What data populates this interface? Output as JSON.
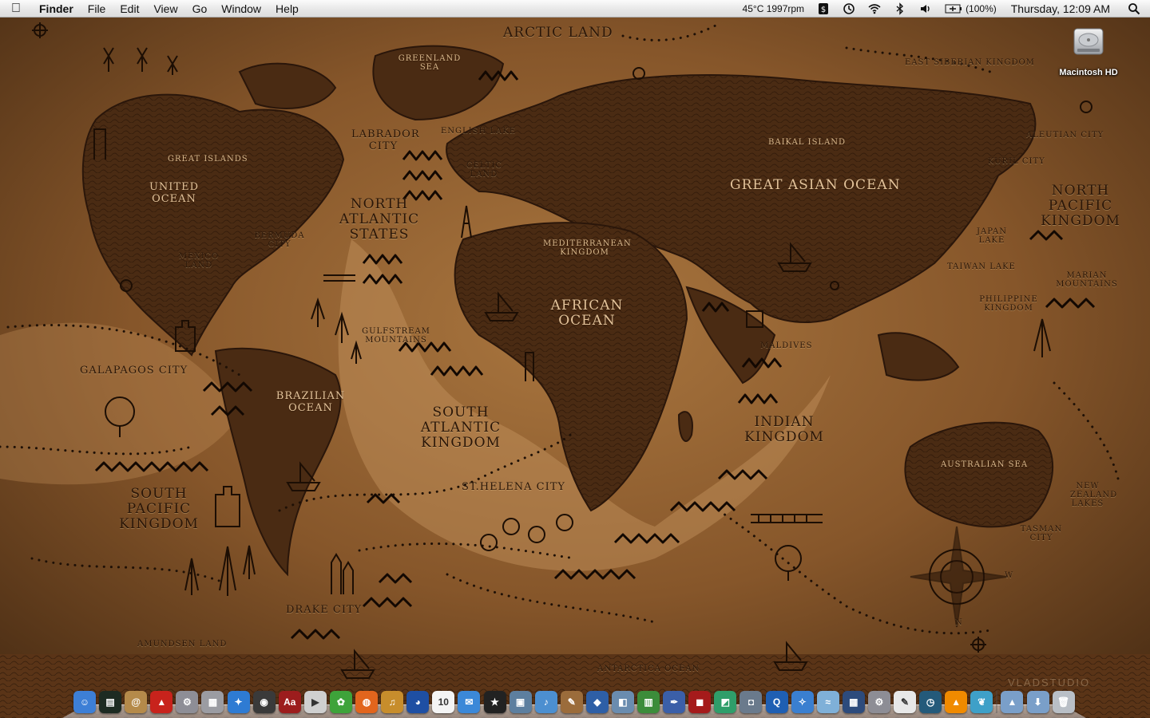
{
  "menubar": {
    "app_name": "Finder",
    "menus": [
      "File",
      "Edit",
      "View",
      "Go",
      "Window",
      "Help"
    ],
    "sensors": "45°C 1997rpm",
    "battery": "(100%)",
    "clock": "Thursday, 12:09 AM"
  },
  "desktop": {
    "hd_label": "Macintosh HD"
  },
  "map": {
    "labels": {
      "arctic_land": "ARCTIC LAND",
      "greenland_sea": "GREENLAND SEA",
      "east_siberian": "EAST SIBERIAN KINGDOM",
      "labrador": "LABRADOR CITY",
      "english_lake": "ENGLISH LAKE",
      "celtic_land": "CELTIC LAND",
      "great_islands": "GREAT ISLANDS",
      "united_ocean": "UNITED OCEAN",
      "baikal": "BAIKAL ISLAND",
      "aleutian": "ALEUTIAN CITY",
      "kuril": "KURIL CITY",
      "great_asian": "GREAT ASIAN OCEAN",
      "north_pacific": "NORTH PACIFIC KINGDOM",
      "north_atlantic": "NORTH ATLANTIC STATES",
      "bermuda": "BERMUDA CITY",
      "mexico": "MEXICO LAND",
      "mediterranean": "MEDITERRANEAN KINGDOM",
      "japan_lake": "JAPAN LAKE",
      "taiwan_lake": "TAIWAN LAKE",
      "marian": "MARIAN MOUNTAINS",
      "philippine": "PHILIPPINE KINGDOM",
      "african_ocean": "AFRICAN OCEAN",
      "gulfstream": "GULFSTREAM MOUNTAINS",
      "maldives": "MALDIVES",
      "galapagos": "GALAPAGOS CITY",
      "brazilian": "BRAZILIAN OCEAN",
      "south_atlantic": "SOUTH ATLANTIC KINGDOM",
      "indian_kingdom": "INDIAN KINGDOM",
      "australian_sea": "AUSTRALIAN SEA",
      "st_helena": "ST.HELENA CITY",
      "new_zealand": "NEW ZEALAND LAKES",
      "south_pacific": "SOUTH PACIFIC KINGDOM",
      "tasman": "TASMAN CITY",
      "drake": "DRAKE CITY",
      "amundsen": "AMUNDSEN LAND",
      "antarctica": "ANTARCTICA OCEAN",
      "compass_w": "W",
      "compass_n": "N"
    },
    "watermark": "VLADSTUDIO"
  },
  "dock": {
    "items": [
      {
        "name": "finder",
        "color": "#3d7fd6",
        "glyph": "☺"
      },
      {
        "name": "activity-monitor",
        "color": "#1d2b22",
        "glyph": "▤"
      },
      {
        "name": "address-book",
        "color": "#b58a4a",
        "glyph": "@"
      },
      {
        "name": "fire-hydrant",
        "color": "#c8231c",
        "glyph": "▲"
      },
      {
        "name": "automator",
        "color": "#8e8e96",
        "glyph": "⚙"
      },
      {
        "name": "calculator",
        "color": "#9b9ca2",
        "glyph": "▦"
      },
      {
        "name": "safari-compass",
        "color": "#2e7bd3",
        "glyph": "✦"
      },
      {
        "name": "dashboard",
        "color": "#3a3a3a",
        "glyph": "◉"
      },
      {
        "name": "dictionary",
        "color": "#9c1d1d",
        "glyph": "Aa"
      },
      {
        "name": "dvd-player",
        "color": "#cfcfcf",
        "glyph": "▶"
      },
      {
        "name": "ichat-frog",
        "color": "#3ea33a",
        "glyph": "✿"
      },
      {
        "name": "firefox",
        "color": "#e2651d",
        "glyph": "◍"
      },
      {
        "name": "garageband",
        "color": "#c78d2c",
        "glyph": "♫"
      },
      {
        "name": "google-earth",
        "color": "#1e4fa3",
        "glyph": "◕"
      },
      {
        "name": "ical",
        "color": "#f4f4f4",
        "glyph": "10"
      },
      {
        "name": "ichat",
        "color": "#3b88d8",
        "glyph": "✉"
      },
      {
        "name": "imovie",
        "color": "#222",
        "glyph": "★"
      },
      {
        "name": "iphoto",
        "color": "#5d7f9f",
        "glyph": "▣"
      },
      {
        "name": "itunes",
        "color": "#4c8fd0",
        "glyph": "♪"
      },
      {
        "name": "iweb",
        "color": "#9b6c3b",
        "glyph": "✎"
      },
      {
        "name": "keynote",
        "color": "#2e5fa6",
        "glyph": "◆"
      },
      {
        "name": "preview",
        "color": "#6a8caf",
        "glyph": "◧"
      },
      {
        "name": "numbers",
        "color": "#3c8c3a",
        "glyph": "▥"
      },
      {
        "name": "pages",
        "color": "#3b5fa8",
        "glyph": "✒"
      },
      {
        "name": "photo-booth",
        "color": "#a51b1b",
        "glyph": "◼"
      },
      {
        "name": "pixelmator",
        "color": "#2f9e6a",
        "glyph": "◩"
      },
      {
        "name": "image-capture",
        "color": "#6a7a8c",
        "glyph": "◘"
      },
      {
        "name": "quicktime",
        "color": "#1f5fb3",
        "glyph": "Q"
      },
      {
        "name": "safari",
        "color": "#3a7fd0",
        "glyph": "✧"
      },
      {
        "name": "fish-app",
        "color": "#7fb0d8",
        "glyph": "≈"
      },
      {
        "name": "spaces",
        "color": "#2d4b7c",
        "glyph": "▦"
      },
      {
        "name": "system-preferences",
        "color": "#8d8d95",
        "glyph": "⚙"
      },
      {
        "name": "textedit",
        "color": "#e8e8e8",
        "glyph": "✎"
      },
      {
        "name": "time-machine",
        "color": "#245a7a",
        "glyph": "◷"
      },
      {
        "name": "vlc",
        "color": "#f08a00",
        "glyph": "▲"
      },
      {
        "name": "sidenote",
        "color": "#3ea0c8",
        "glyph": "❦"
      },
      {
        "name": "applications-folder",
        "color": "#7a9fc9",
        "glyph": "▲"
      },
      {
        "name": "downloads-folder",
        "color": "#7a9fc9",
        "glyph": "⬇"
      },
      {
        "name": "trash",
        "color": "#b9bfc6",
        "glyph": "🗑"
      }
    ]
  }
}
